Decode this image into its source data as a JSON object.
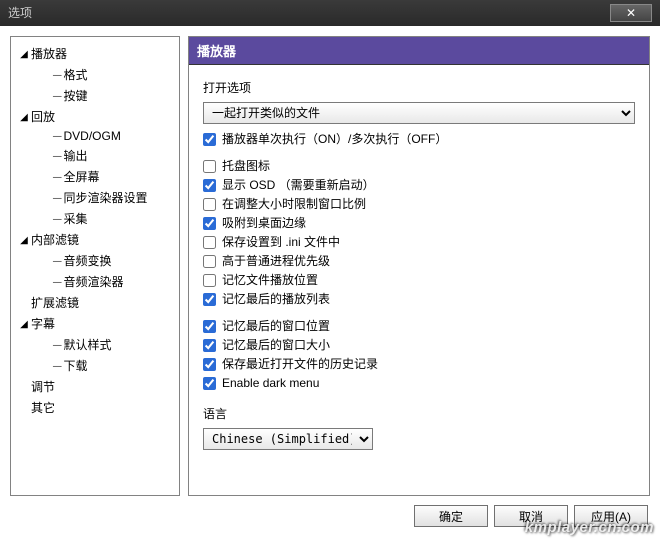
{
  "window": {
    "title": "选项"
  },
  "tree": [
    {
      "label": "播放器",
      "expanded": true,
      "children": [
        {
          "label": "格式"
        },
        {
          "label": "按键"
        }
      ]
    },
    {
      "label": "回放",
      "expanded": true,
      "children": [
        {
          "label": "DVD/OGM"
        },
        {
          "label": "输出"
        },
        {
          "label": "全屏幕"
        },
        {
          "label": "同步渲染器设置"
        },
        {
          "label": "采集"
        }
      ]
    },
    {
      "label": "内部滤镜",
      "expanded": true,
      "children": [
        {
          "label": "音频变换"
        },
        {
          "label": "音频渲染器"
        }
      ]
    },
    {
      "label": "扩展滤镜",
      "expanded": false
    },
    {
      "label": "字幕",
      "expanded": true,
      "children": [
        {
          "label": "默认样式"
        },
        {
          "label": "下载"
        }
      ]
    },
    {
      "label": "调节",
      "expanded": false
    },
    {
      "label": "其它",
      "expanded": false
    }
  ],
  "panel": {
    "title": "播放器",
    "open_group_label": "打开选项",
    "open_select_value": "一起打开类似的文件",
    "checks_top": [
      {
        "label": "播放器单次执行（ON）/多次执行（OFF）",
        "checked": true
      }
    ],
    "checks_mid": [
      {
        "label": "托盘图标",
        "checked": false
      },
      {
        "label": "显示 OSD （需要重新启动）",
        "checked": true
      },
      {
        "label": "在调整大小时限制窗口比例",
        "checked": false
      },
      {
        "label": "吸附到桌面边缘",
        "checked": true
      },
      {
        "label": "保存设置到 .ini 文件中",
        "checked": false
      },
      {
        "label": "高于普通进程优先级",
        "checked": false
      },
      {
        "label": "记忆文件播放位置",
        "checked": false
      },
      {
        "label": "记忆最后的播放列表",
        "checked": true
      }
    ],
    "checks_bottom": [
      {
        "label": "记忆最后的窗口位置",
        "checked": true
      },
      {
        "label": "记忆最后的窗口大小",
        "checked": true
      },
      {
        "label": "保存最近打开文件的历史记录",
        "checked": true
      },
      {
        "label": "Enable dark menu",
        "checked": true
      }
    ],
    "lang_label": "语言",
    "lang_value": "Chinese (Simplified)"
  },
  "footer": {
    "ok": "确定",
    "cancel": "取消",
    "apply": "应用(A)"
  },
  "watermark": "kmplayer.cn.com"
}
